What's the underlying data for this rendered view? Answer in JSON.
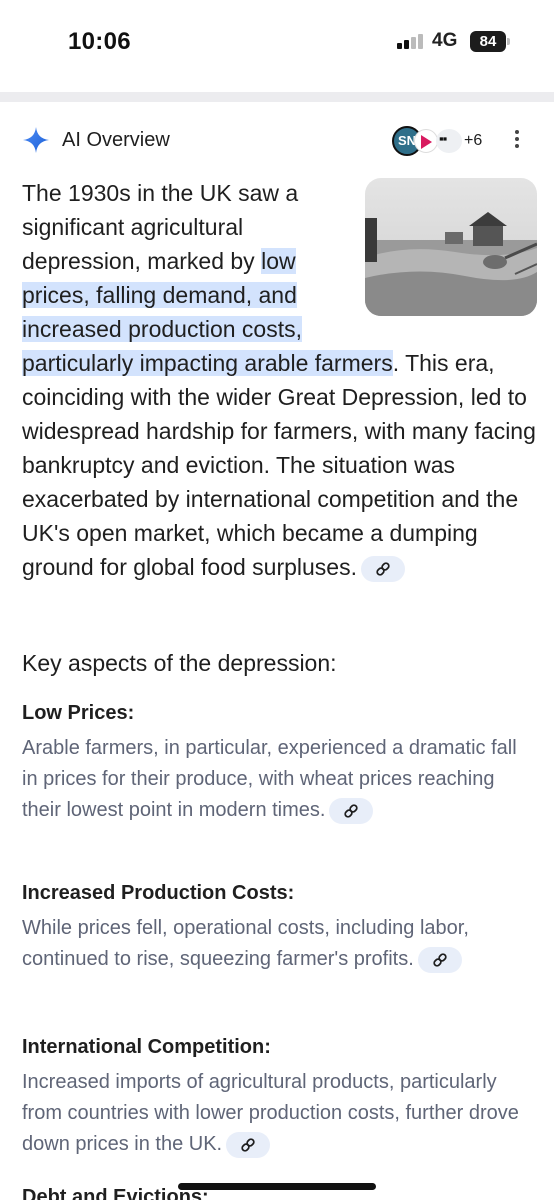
{
  "status_bar": {
    "time": "10:06",
    "network": "4G",
    "battery": "84"
  },
  "ai_overview": {
    "title": "AI Overview",
    "source_badge": "SN",
    "more_sources": "+6",
    "intro": {
      "part1": "The 1930s in the UK saw a significant agricultural depression, marked by ",
      "highlight": "low prices, falling demand, and increased production costs, particularly impacting arable farmers",
      "part2": ". This era, coinciding with the wider Great Depression, led to widespread hardship for farmers, with many facing bankruptcy and eviction. The situation was exacerbated by international competition and the UK's open market, which became a dumping ground for global food surpluses."
    },
    "section_title": "Key aspects of the depression:",
    "aspects": [
      {
        "heading": "Low Prices:",
        "text": "Arable farmers, in particular, experienced a dramatic fall in prices for their produce, with wheat prices reaching their lowest point in modern times."
      },
      {
        "heading": "Increased Production Costs:",
        "text": "While prices fell, operational costs, including labor, continued to rise, squeezing farmer's profits."
      },
      {
        "heading": "International Competition:",
        "text": "Increased imports of agricultural products, particularly from countries with lower production costs, further drove down prices in the UK."
      },
      {
        "heading": "Debt and Evictions:"
      }
    ]
  },
  "icons": [
    "sparkle-icon",
    "link-icon",
    "more-vert-icon",
    "signal-icon",
    "battery-icon"
  ],
  "colors": {
    "accent": "#1a73e8",
    "highlight": "#d3e3fd",
    "secondary_text": "#5f6577"
  }
}
